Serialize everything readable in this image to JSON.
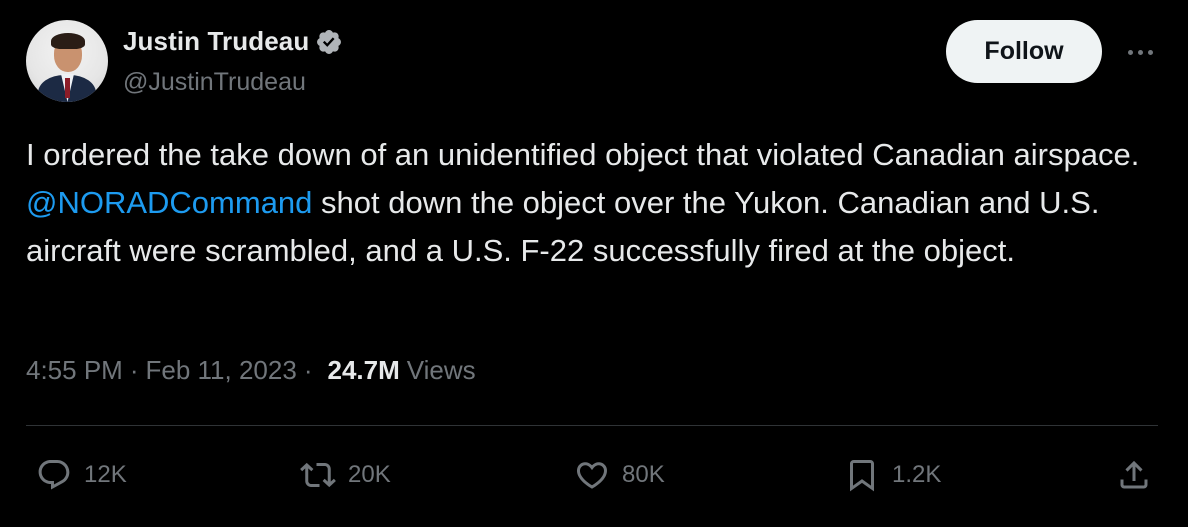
{
  "author": {
    "name": "Justin Trudeau",
    "handle": "@JustinTrudeau",
    "verified": true
  },
  "follow_button": {
    "label": "Follow"
  },
  "tweet": {
    "text_before": "I ordered the take down of an unidentified object that violated Canadian airspace. ",
    "mention": "@NORADCommand",
    "text_after": " shot down the object over the Yukon. Canadian and U.S. aircraft were scrambled, and a U.S. F-22 successfully fired at the object."
  },
  "meta": {
    "time": "4:55 PM",
    "separator": "·",
    "date": "Feb 11, 2023",
    "views_count": "24.7M",
    "views_label": "Views"
  },
  "actions": {
    "replies": "12K",
    "retweets": "20K",
    "likes": "80K",
    "bookmarks": "1.2K"
  },
  "icons": {
    "verified": "verified-badge-icon",
    "more": "more-horizontal-icon",
    "reply": "reply-icon",
    "retweet": "retweet-icon",
    "like": "heart-icon",
    "bookmark": "bookmark-icon",
    "share": "share-icon"
  },
  "colors": {
    "background": "#000000",
    "text": "#e7e9ea",
    "secondary": "#71767b",
    "link": "#1d9bf0",
    "follow_bg": "#eff3f4"
  }
}
